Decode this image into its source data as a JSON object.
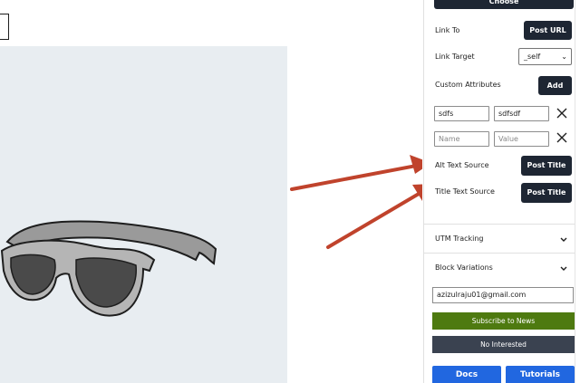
{
  "sidebar": {
    "choose_label": "Choose",
    "link_to": {
      "label": "Link To",
      "button": "Post URL"
    },
    "link_target": {
      "label": "Link Target",
      "value": "_self"
    },
    "custom_attributes": {
      "label": "Custom Attributes",
      "button": "Add"
    },
    "attributes": [
      {
        "name": "sdfs",
        "value": "sdfsdf"
      }
    ],
    "new_attribute": {
      "name_placeholder": "Name",
      "value_placeholder": "Value"
    },
    "alt_text_source": {
      "label": "Alt Text Source",
      "button": "Post Title"
    },
    "title_text_source": {
      "label": "Title Text Source",
      "button": "Post Title"
    },
    "panels": [
      {
        "title": "UTM Tracking"
      },
      {
        "title": "Block Variations"
      }
    ],
    "subscribe": {
      "email": "azizulraju01@gmail.com",
      "subscribe_label": "Subscribe to News",
      "not_interested_label": "No Interested"
    },
    "footer": {
      "docs_label": "Docs",
      "tutorials_label": "Tutorials"
    }
  },
  "colors": {
    "dark_button": "#1e2633",
    "arrow": "#c0432c",
    "subscribe_green": "#4e7a10",
    "blue_button": "#2167e0",
    "image_background": "#e8edf1"
  },
  "icons": [
    "close-icon",
    "chevron-down-icon",
    "arrow-annotation"
  ]
}
